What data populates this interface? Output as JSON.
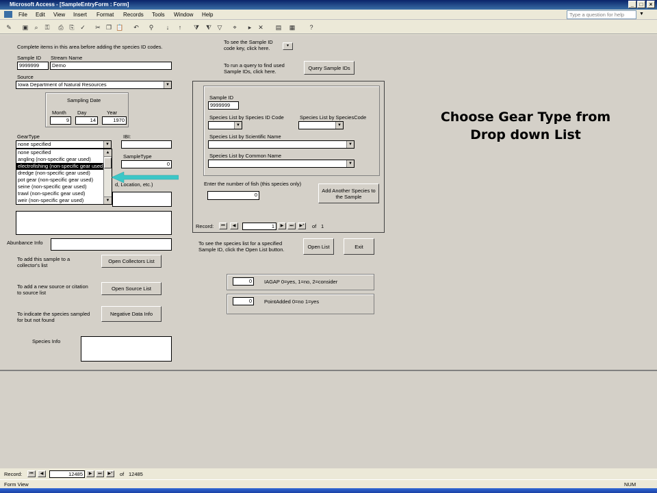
{
  "window": {
    "title": "Microsoft Access - [SampleEntryForm : Form]"
  },
  "menu": [
    "File",
    "Edit",
    "View",
    "Insert",
    "Format",
    "Records",
    "Tools",
    "Window",
    "Help"
  ],
  "help_placeholder": "Type a question for help",
  "form": {
    "intro": "Complete items in this area before adding the species ID codes.",
    "sample_id_label": "Sample ID",
    "sample_id": "9999999",
    "stream_name_label": "Stream Name",
    "stream_name": "Demo",
    "source_label": "Source",
    "source": "Iowa Department of Natural Resources",
    "sampling_date_label": "Sampling Date",
    "month_label": "Month",
    "month": "9",
    "day_label": "Day",
    "day": "14",
    "year_label": "Year",
    "year": "1970",
    "geartype_label": "GearType",
    "geartype": "none specified",
    "gear_options": [
      "none specified",
      "angling (non-specific gear used)",
      "electrofishing (non-specific gear used)",
      "dredge (non-specific gear used)",
      "pot gear (non-specific gear used)",
      "seine (non-specific gear used)",
      "trawl (non-specific gear used)",
      "weir (non-specific gear used)"
    ],
    "ibi_label": "IBI:",
    "sampletype_label": "SampleType",
    "sampletype": "0",
    "location_fragment": "d, Location, etc.)",
    "abundance_label": "Abunbance Info",
    "collectors_text": "To add this sample to a collector's list",
    "collectors_btn": "Open Collectors List",
    "source_text": "To add a new source or citation to source list",
    "source_btn": "Open Source List",
    "negative_text": "To indicate the species sampled for but not found",
    "negative_btn": "Negative Data Info",
    "species_info_label": "Species Info",
    "key_text": "To see the Sample ID code key, click here.",
    "query_text": "To run a query to find used Sample IDs, click here.",
    "query_btn": "Query Sample IDs",
    "sub": {
      "sample_id_label": "Sample ID",
      "sample_id": "9999999",
      "by_id_label": "Species List by Species ID Code",
      "by_code_label": "Species List by SpeciesCode",
      "by_sci_label": "Species List by Scientific Name",
      "by_common_label": "Species List by Common Name",
      "fish_count_label": "Enter the number of fish (this species only)",
      "fish_count": "0",
      "add_btn": "Add Another Species to the Sample",
      "record_label": "Record:",
      "record_current": "1",
      "record_of": "of",
      "record_total": "1"
    },
    "openlist_text": "To see the species list for a specified Sample ID, click the Open List button.",
    "openlist_btn": "Open List",
    "exit_btn": "Exit",
    "iagap_value": "0",
    "iagap_label": "IAGAP 0=yes, 1=no, 2=consider",
    "pointadded_value": "0",
    "pointadded_label": "PointAdded 0=no 1=yes"
  },
  "callout": "Choose Gear Type from Drop down List",
  "records": {
    "label": "Record:",
    "current": "12485",
    "of": "of",
    "total": "12485"
  },
  "status": {
    "left": "Form View",
    "right": "NUM"
  }
}
